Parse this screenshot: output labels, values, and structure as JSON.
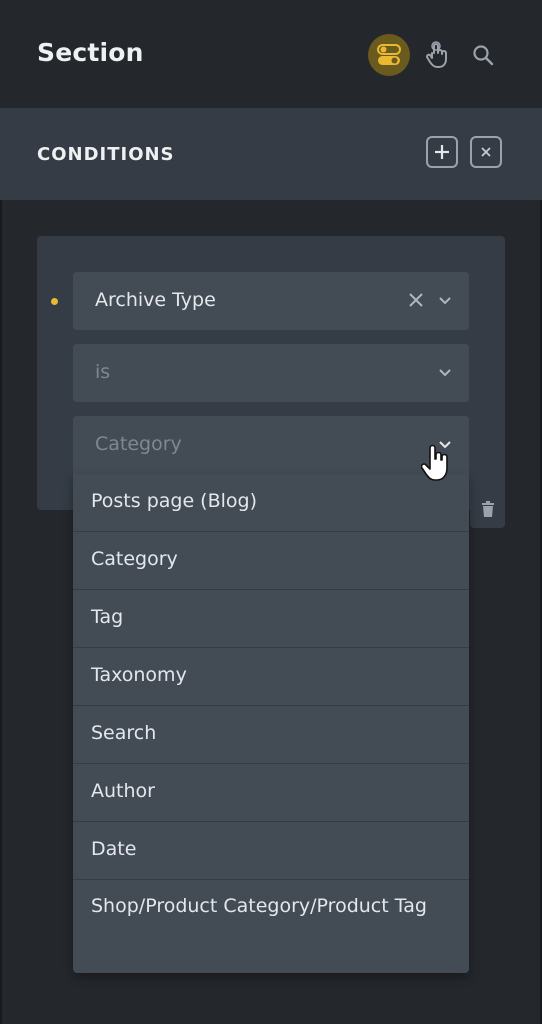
{
  "header": {
    "title": "Section"
  },
  "icons": {
    "toggle": "toggle-icon",
    "pointer": "pointer-hand-icon",
    "search": "search-icon",
    "add": "plus-icon",
    "close": "close-icon",
    "trash": "trash-icon"
  },
  "conditions": {
    "title": "CONDITIONS"
  },
  "condition": {
    "type_value": "Archive Type",
    "operator_placeholder": "is",
    "value_placeholder": "Category"
  },
  "dropdown": {
    "options": [
      "Posts page (Blog)",
      "Category",
      "Tag",
      "Taxonomy",
      "Search",
      "Author",
      "Date",
      "Shop/Product Category/Product Tag"
    ]
  },
  "colors": {
    "accent": "#e8b931",
    "panel": "#353c45",
    "field": "#434b55",
    "bg": "#24272c"
  }
}
